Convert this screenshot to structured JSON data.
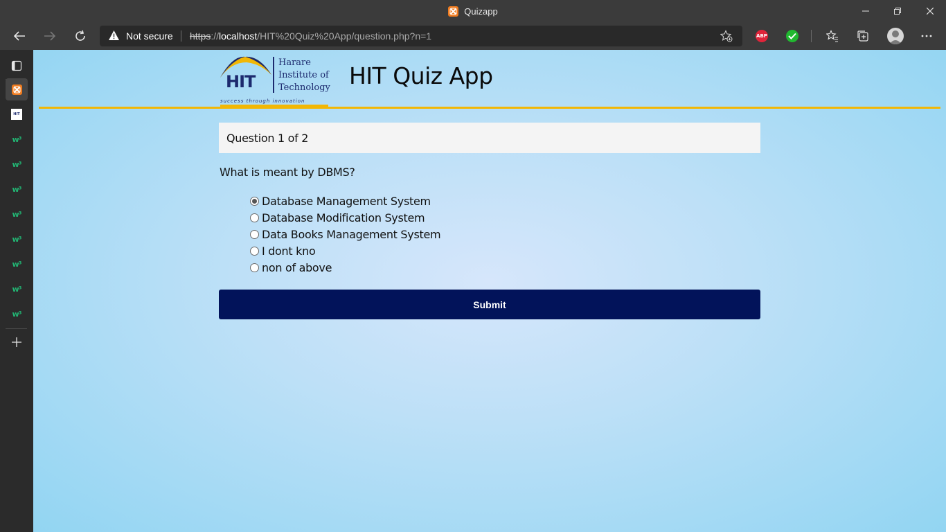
{
  "window": {
    "title": "Quizapp",
    "favicon_color": "#f07c20"
  },
  "toolbar": {
    "security_label": "Not secure",
    "url_scheme": "https",
    "url_sep": "://",
    "url_host": "localhost",
    "url_path": "/HIT%20Quiz%20App/question.php?n=1",
    "abp_label": "ABP"
  },
  "sidebar": {
    "tabs": [
      {
        "icon": "tab-actions-icon"
      },
      {
        "icon": "xampp-icon",
        "active": true
      },
      {
        "icon": "hit-logo-icon"
      },
      {
        "icon": "w-site-icon"
      },
      {
        "icon": "w-site-icon"
      },
      {
        "icon": "w-site-icon"
      },
      {
        "icon": "w-site-icon"
      },
      {
        "icon": "w-site-icon"
      },
      {
        "icon": "w-site-icon"
      },
      {
        "icon": "w-site-icon"
      },
      {
        "icon": "w-site-icon"
      }
    ],
    "w_glyph": "w³",
    "hit_glyph": "HIT"
  },
  "page": {
    "logo": {
      "abbr": "HIT",
      "line1": "Harare",
      "line2": "Institute of",
      "line3": "Technology",
      "tagline": "success through innovation"
    },
    "app_title": "HIT Quiz App",
    "question_counter": "Question 1 of 2",
    "question_text": "What is meant by DBMS?",
    "choices": [
      {
        "label": "Database Management System",
        "checked": true
      },
      {
        "label": "Database Modification System",
        "checked": false
      },
      {
        "label": "Data Books Management System",
        "checked": false
      },
      {
        "label": "I dont kno",
        "checked": false
      },
      {
        "label": "non of above",
        "checked": false
      }
    ],
    "submit_label": "Submit"
  },
  "colors": {
    "accent_line": "#f2b705",
    "submit_bg": "#02135a",
    "logo_navy": "#1c2a6e"
  }
}
